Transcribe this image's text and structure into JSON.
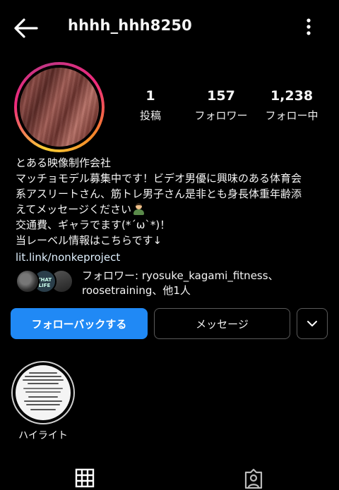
{
  "header": {
    "username": "hhhh_hhh8250",
    "back_icon": "arrow-left-icon",
    "more_icon": "more-vertical-icon"
  },
  "stats": {
    "posts_count": "1",
    "posts_label": "投稿",
    "followers_count": "157",
    "followers_label": "フォロワー",
    "following_count": "1,238",
    "following_label": "フォロー中"
  },
  "bio": {
    "lines": [
      "とある映像制作会社",
      "マッチョモデル募集中です！ビデオ男優に興味のある体育会",
      "系アスリートさん、筋トレ男子さん是非とも身長体重年齢添",
      "えてメッセージください",
      "交通費、ギャラでます(*´ω`*)！",
      "当レーベル情報はこちらです↓"
    ],
    "link": "lit.link/nonkeproject"
  },
  "followed_by": {
    "avatar2_text": "THAT LIFE",
    "text": "フォロワー: ryosuke_kagami_fitness、roosetraining、他1人"
  },
  "actions": {
    "follow_back_label": "フォローバックする",
    "message_label": "メッセージ",
    "dropdown_icon": "chevron-down-icon"
  },
  "highlights": [
    {
      "label": "ハイライト"
    }
  ],
  "tabs": [
    {
      "icon": "grid-icon"
    },
    {
      "icon": "tagged-person-icon"
    }
  ],
  "colors": {
    "background": "#000000",
    "primary_button": "#2089f5",
    "text": "#f5f5f5"
  }
}
